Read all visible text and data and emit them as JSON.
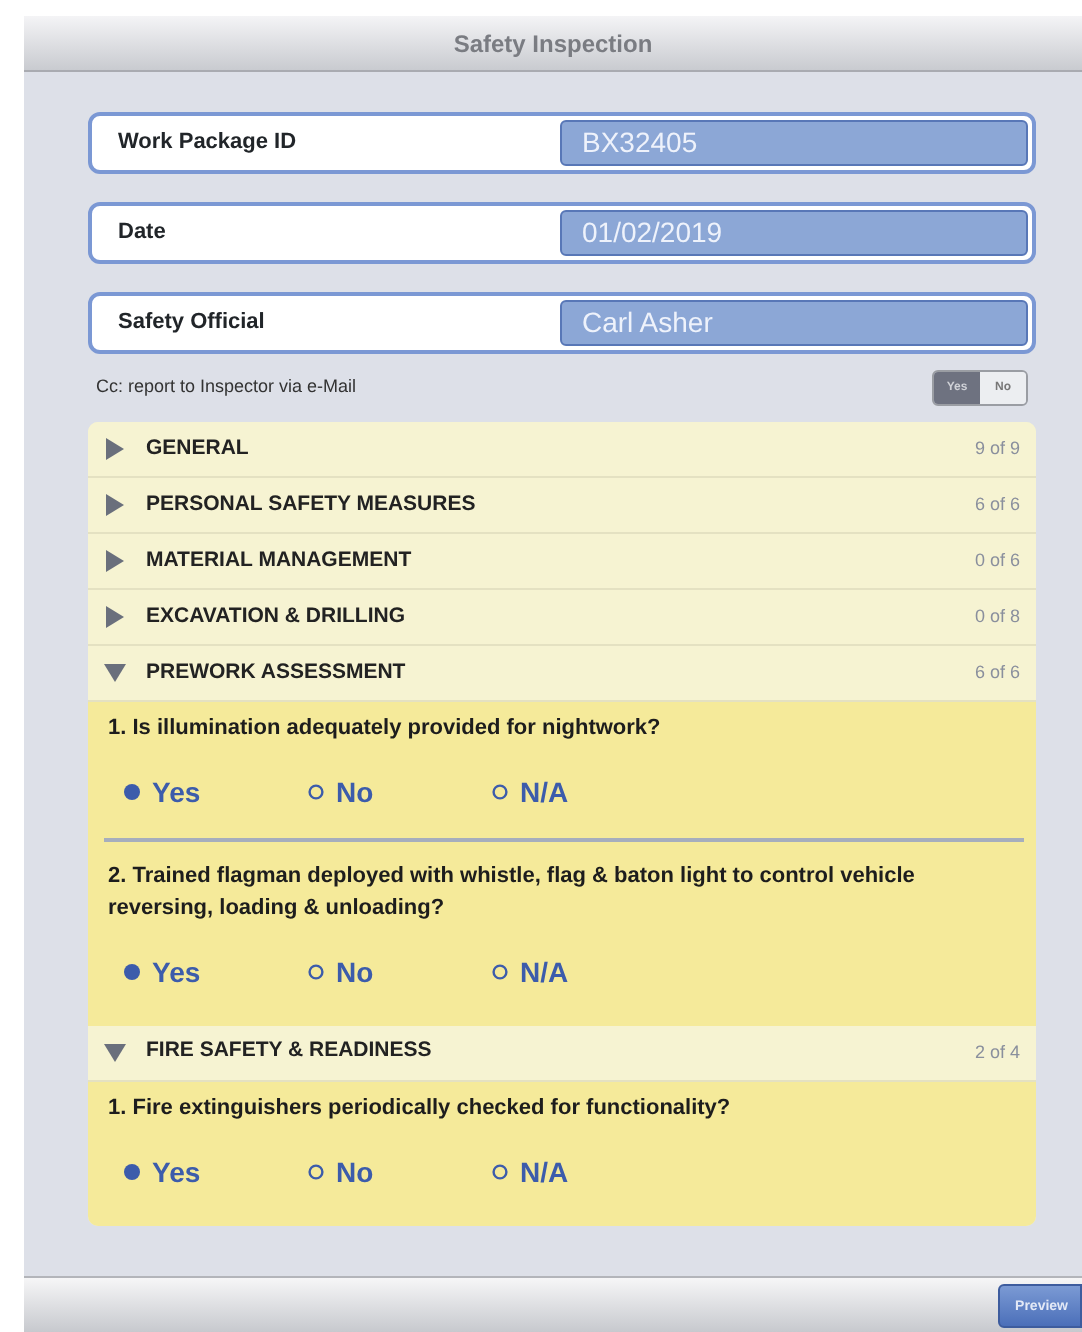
{
  "window": {
    "title": "Safety Inspection"
  },
  "fields": [
    {
      "label": "Work Package ID",
      "value": "BX32405"
    },
    {
      "label": "Date",
      "value": "01/02/2019"
    },
    {
      "label": "Safety Official",
      "value": "Carl Asher"
    }
  ],
  "cc": {
    "label": "Cc: report to Inspector via e-Mail",
    "options": [
      {
        "label": "Yes",
        "selected": true
      },
      {
        "label": "No",
        "selected": false
      }
    ]
  },
  "sections": [
    {
      "title": "GENERAL",
      "count": "9 of 9",
      "expanded": false
    },
    {
      "title": "PERSONAL SAFETY MEASURES",
      "count": "6 of 6",
      "expanded": false
    },
    {
      "title": "MATERIAL MANAGEMENT",
      "count": "0 of 6",
      "expanded": false
    },
    {
      "title": "EXCAVATION & DRILLING",
      "count": "0 of 8",
      "expanded": false
    },
    {
      "title": "PREWORK ASSESSMENT",
      "count": "6 of 6",
      "expanded": true,
      "questions": [
        {
          "text": "1. Is illumination adequately provided for nightwork?",
          "answers": [
            {
              "label": "Yes",
              "selected": true
            },
            {
              "label": "No",
              "selected": false
            },
            {
              "label": "N/A",
              "selected": false
            }
          ]
        },
        {
          "text": "2. Trained flagman deployed with whistle, flag & baton light to control vehicle reversing, loading & unloading?",
          "answers": [
            {
              "label": "Yes",
              "selected": true
            },
            {
              "label": "No",
              "selected": false
            },
            {
              "label": "N/A",
              "selected": false
            }
          ]
        }
      ]
    },
    {
      "title": "FIRE SAFETY & READINESS",
      "count": "2 of 4",
      "expanded": true,
      "questions": [
        {
          "text": "1. Fire extinguishers periodically checked for functionality?",
          "answers": [
            {
              "label": "Yes",
              "selected": true
            },
            {
              "label": "No",
              "selected": false
            },
            {
              "label": "N/A",
              "selected": false
            }
          ]
        }
      ]
    }
  ],
  "toolbar": {
    "button": "Preview"
  }
}
